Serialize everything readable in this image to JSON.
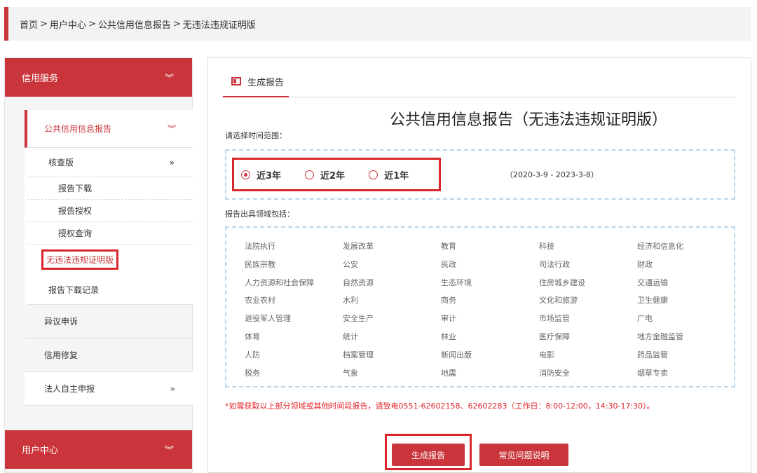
{
  "breadcrumb": [
    "首页",
    "用户中心",
    "公共信用信息报告",
    "无违法违规证明版"
  ],
  "breadcrumb_sep": ">",
  "colors": {
    "accent": "#c9353a",
    "highlight": "#d9262c",
    "dashed_border": "#b9d6ea"
  },
  "sidebar": {
    "header": "信用服务",
    "header_icon": "chevron-double-down-icon",
    "items": {
      "public_report": "公共信用信息报告",
      "check_version": "核查版",
      "check_sub": [
        "报告下载",
        "报告授权",
        "授权查询"
      ],
      "no_violation": "无违法违规证明版",
      "download_record": "报告下载记录",
      "objection": "异议申诉",
      "repair": "信用修复",
      "self_report": "法人自主申报"
    },
    "footer": "用户中心",
    "chev_down": "︾",
    "chev_right": "»"
  },
  "main": {
    "tab": "生成报告",
    "title": "公共信用信息报告（无违法违规证明版）",
    "time_label": "请选择时间范围：",
    "radios": [
      "近3年",
      "近2年",
      "近1年"
    ],
    "selected_radio": "近3年",
    "range_text": "（2020-3-9  -  2023-3-8）",
    "domain_label": "报告出具领域包括：",
    "domains": [
      "法院执行",
      "发展改革",
      "教育",
      "科技",
      "经济和信息化",
      "民族宗教",
      "公安",
      "民政",
      "司法行政",
      "财政",
      "人力资源和社会保障",
      "自然资源",
      "生态环境",
      "住房城乡建设",
      "交通运输",
      "农业农村",
      "水利",
      "商务",
      "文化和旅游",
      "卫生健康",
      "退役军人管理",
      "安全生产",
      "审计",
      "市场监管",
      "广电",
      "体育",
      "统计",
      "林业",
      "医疗保障",
      "地方金融监管",
      "人防",
      "档案管理",
      "新闻出版",
      "电影",
      "药品监管",
      "税务",
      "气象",
      "地震",
      "消防安全",
      "烟草专卖"
    ],
    "note": "*如需获取以上部分领域或其他时间段报告，请致电0551-62602158、62602283（工作日：8:00-12:00，14:30-17:30）。",
    "generate_button": "生成报告",
    "faq_button": "常见问题说明"
  }
}
